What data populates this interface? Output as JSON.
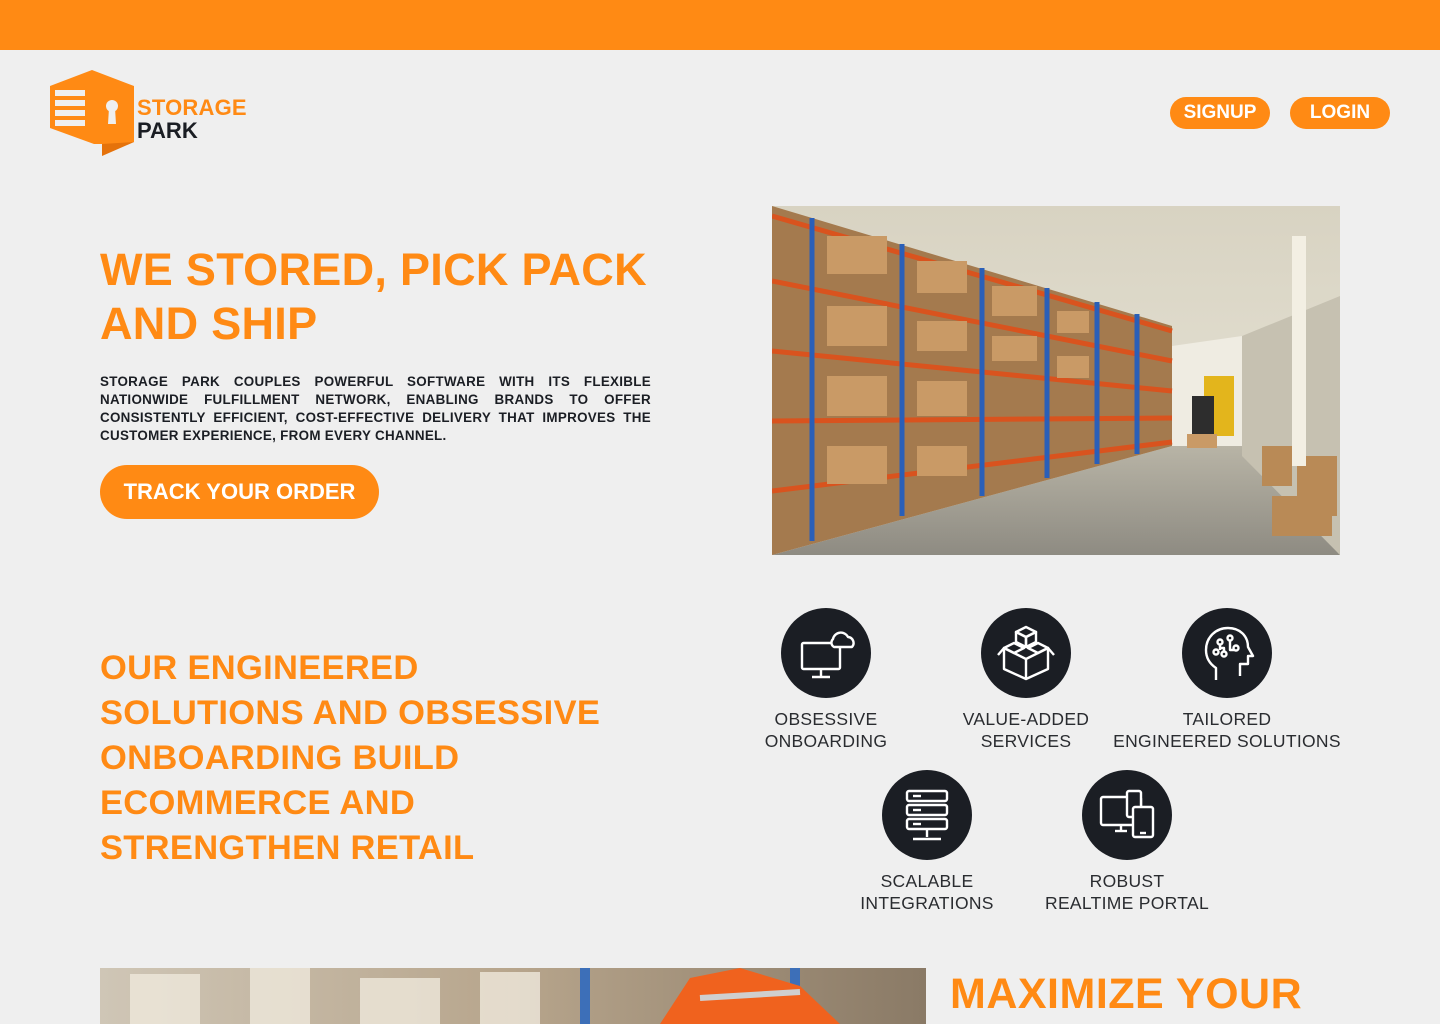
{
  "brand": {
    "name_line1": "STORAGE",
    "name_line2": "PARK",
    "accent_color": "#ff8a14",
    "dark_color": "#1b1e24"
  },
  "nav": {
    "signup_label": "SIGNUP",
    "login_label": "LOGIN"
  },
  "hero": {
    "title": "WE STORED, PICK PACK AND SHIP",
    "description": "STORAGE PARK COUPLES POWERFUL SOFTWARE WITH ITS FLEXIBLE NATIONWIDE FULFILLMENT NETWORK, ENABLING BRANDS TO OFFER CONSISTENTLY EFFICIENT, COST-EFFECTIVE DELIVERY THAT IMPROVES THE CUSTOMER EXPERIENCE, FROM EVERY CHANNEL.",
    "cta_label": "TRACK YOUR ORDER",
    "image_icon": "warehouse-photo"
  },
  "solutions": {
    "title": "OUR ENGINEERED SOLUTIONS AND OBSESSIVE ONBOARDING BUILD ECOMMERCE AND STRENGTHEN RETAIL",
    "features": [
      {
        "icon": "monitor-cloud-icon",
        "line1": "OBSESSIVE",
        "line2": "ONBOARDING"
      },
      {
        "icon": "boxes-icon",
        "line1": "VALUE-ADDED",
        "line2": "SERVICES"
      },
      {
        "icon": "brain-circuit-icon",
        "line1": "TAILORED",
        "line2": "ENGINEERED SOLUTIONS"
      },
      {
        "icon": "server-stack-icon",
        "line1": "SCALABLE",
        "line2": "INTEGRATIONS"
      },
      {
        "icon": "devices-icon",
        "line1": "ROBUST",
        "line2": "REALTIME PORTAL"
      }
    ]
  },
  "next_section": {
    "title_partial": "MAXIMIZE YOUR"
  }
}
